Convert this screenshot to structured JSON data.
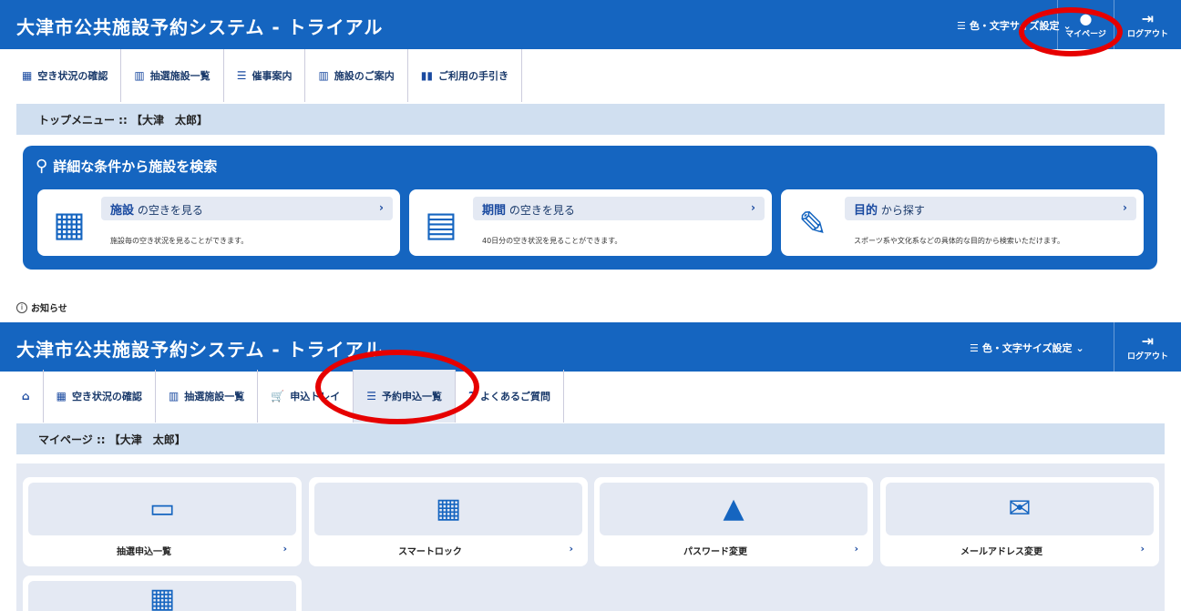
{
  "top_screen": {
    "header": {
      "title": "大津市公共施設予約システム - トライアル",
      "settings_label": "色・文字サイズ設定",
      "mypage_label": "マイページ",
      "logout_label": "ログアウト"
    },
    "nav": [
      {
        "icon": "calendar-icon",
        "label": "空き状況の確認"
      },
      {
        "icon": "building-icon",
        "label": "抽選施設一覧"
      },
      {
        "icon": "list-icon",
        "label": "催事案内"
      },
      {
        "icon": "building-info-icon",
        "label": "施設のご案内"
      },
      {
        "icon": "book-icon",
        "label": "ご利用の手引き"
      }
    ],
    "breadcrumb": "トップメニュー :: 【大津　太郎】",
    "search_panel": {
      "title": "詳細な条件から施設を検索",
      "cards": [
        {
          "icon": "building-icon",
          "strong": "施設",
          "rest": " の空きを見る",
          "desc": "施設毎の空き状況を見ることができます。"
        },
        {
          "icon": "calendar-icon",
          "strong": "期間",
          "rest": " の空きを見る",
          "desc": "40日分の空き状況を見ることができます。"
        },
        {
          "icon": "edit-icon",
          "strong": "目的",
          "rest": " から探す",
          "desc": "スポーツ系や文化系などの具体的な目的から検索いただけます。"
        }
      ]
    },
    "notice": "お知らせ"
  },
  "mypage_screen": {
    "header": {
      "title": "大津市公共施設予約システム - トライアル",
      "settings_label": "色・文字サイズ設定",
      "logout_label": "ログアウト"
    },
    "nav": [
      {
        "icon": "calendar-icon",
        "label": "空き状況の確認"
      },
      {
        "icon": "building-icon",
        "label": "抽選施設一覧"
      },
      {
        "icon": "cart-icon",
        "label": "申込トレイ"
      },
      {
        "icon": "list-icon",
        "label": "予約申込一覧"
      },
      {
        "icon": "question-icon",
        "label": "よくあるご質問"
      }
    ],
    "breadcrumb": "マイページ :: 【大津　太郎】",
    "cards": [
      {
        "icon": "calendar-icon",
        "label": "抽選申込一覧"
      },
      {
        "icon": "building-lock-icon",
        "label": "スマートロック"
      },
      {
        "icon": "lock-icon",
        "label": "パスワード変更"
      },
      {
        "icon": "mail-icon",
        "label": "メールアドレス変更"
      }
    ]
  },
  "colors": {
    "primary": "#1565c0",
    "highlight": "#e60000",
    "soft": "#e4e9f3"
  }
}
